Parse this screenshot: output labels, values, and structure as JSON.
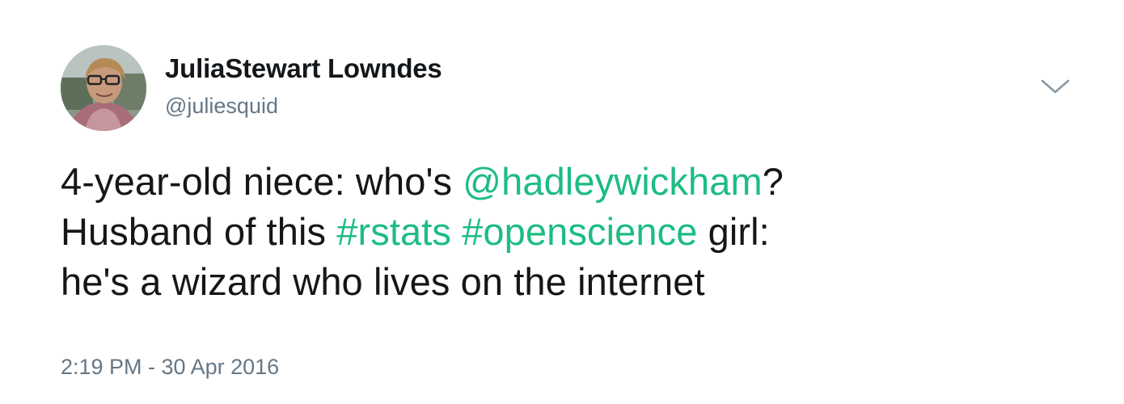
{
  "user": {
    "display_name": "JuliaStewart Lowndes",
    "handle": "@juliesquid",
    "avatar_icon": "profile-photo"
  },
  "menu": {
    "caret_icon": "chevron-down-icon"
  },
  "tweet": {
    "line1_text": "4-year-old niece: who's ",
    "mention": "@hadleywickham",
    "line1_end": "?",
    "line2_text": "Husband of this ",
    "hashtag1": "#rstats",
    "space": " ",
    "hashtag2": "#openscience",
    "line2_end": " girl:",
    "line3_text": "he's a wizard who lives on the internet",
    "timestamp": "2:19 PM - 30 Apr 2016"
  },
  "colors": {
    "link": "#1dbc82",
    "text": "#14171a",
    "secondary": "#657786"
  }
}
